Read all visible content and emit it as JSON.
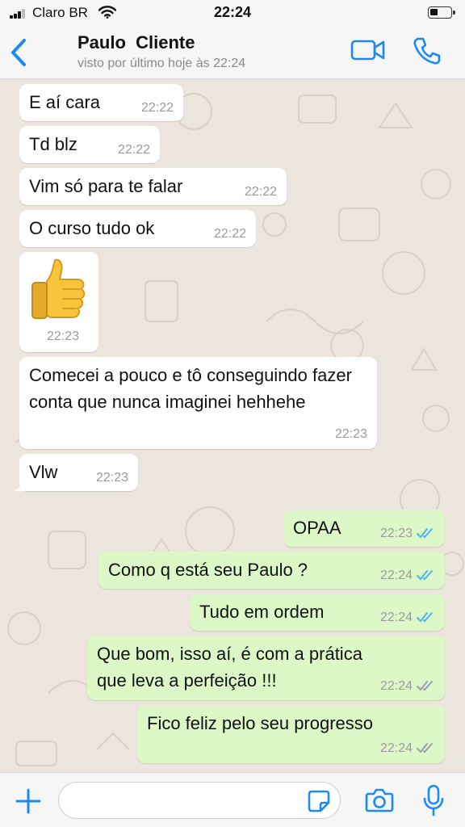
{
  "status_bar": {
    "carrier": "Claro BR",
    "time": "22:24"
  },
  "header": {
    "contact_name": "Paulo  Cliente",
    "last_seen": "visto por último hoje às 22:24",
    "icons": [
      "chevron-left-icon",
      "video-camera-icon",
      "phone-icon"
    ]
  },
  "colors": {
    "accent": "#1b8af5",
    "incoming_bubble": "#ffffff",
    "outgoing_bubble": "#dcf8c6",
    "read_ticks": "#4fb3f7",
    "delivered_ticks": "#9aa0a4",
    "chat_background": "#ece5dd"
  },
  "messages": [
    {
      "direction": "in",
      "text": "E aí cara",
      "time": "22:22"
    },
    {
      "direction": "in",
      "text": "Td blz",
      "time": "22:22"
    },
    {
      "direction": "in",
      "text": "Vim só para te falar",
      "time": "22:22"
    },
    {
      "direction": "in",
      "text": "O curso tudo ok",
      "time": "22:22"
    },
    {
      "direction": "in",
      "text": "",
      "sticker": "thumbs-up-emoji",
      "time": "22:23"
    },
    {
      "direction": "in",
      "text": "Comecei a pouco e tô conseguindo fazer conta que nunca imaginei hehhehe",
      "time": "22:23"
    },
    {
      "direction": "in",
      "text": "Vlw",
      "time": "22:23"
    },
    {
      "direction": "out",
      "text": "OPAA",
      "time": "22:23",
      "status": "read"
    },
    {
      "direction": "out",
      "text": "Como q está seu Paulo ?",
      "time": "22:24",
      "status": "read"
    },
    {
      "direction": "out",
      "text": "Tudo em ordem",
      "time": "22:24",
      "status": "read"
    },
    {
      "direction": "out",
      "text": "Que bom, isso aí, é com a prática que leva a perfeição !!!",
      "time": "22:24",
      "status": "delivered"
    },
    {
      "direction": "out",
      "text": "Fico feliz pelo seu progresso",
      "time": "22:24",
      "status": "delivered"
    }
  ],
  "input_bar": {
    "placeholder": "",
    "icons": [
      "plus-icon",
      "sticker-icon",
      "camera-icon",
      "microphone-icon"
    ]
  }
}
